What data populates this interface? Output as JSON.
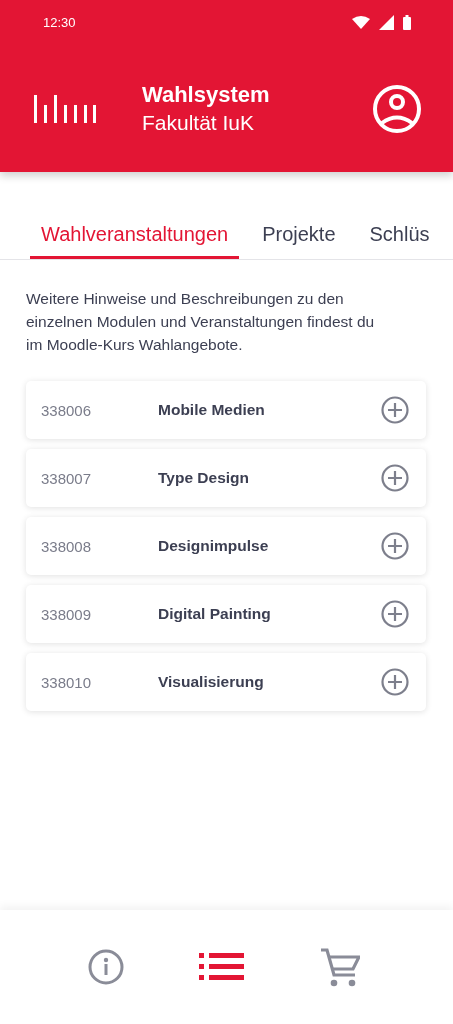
{
  "status_bar": {
    "time": "12:30"
  },
  "header": {
    "title": "Wahlsystem",
    "subtitle": "Fakultät IuK"
  },
  "tabs": [
    {
      "label": "Wahlveranstaltungen",
      "selected": true
    },
    {
      "label": "Projekte",
      "selected": false
    },
    {
      "label": "Schlüs",
      "selected": false
    }
  ],
  "intro": "Weitere Hinweise und Beschreibungen zu den einzelnen Modulen und Veranstaltungen findest du im Moodle-Kurs Wahlangebote.",
  "courses": [
    {
      "number": "338006",
      "name": "Mobile Medien"
    },
    {
      "number": "338007",
      "name": "Type Design"
    },
    {
      "number": "338008",
      "name": "Designimpulse"
    },
    {
      "number": "338009",
      "name": "Digital Painting"
    },
    {
      "number": "338010",
      "name": "Visualisierung"
    }
  ],
  "bottom_nav": [
    {
      "kind": "info",
      "selected": false
    },
    {
      "kind": "list",
      "selected": true
    },
    {
      "kind": "cart",
      "selected": false
    }
  ]
}
